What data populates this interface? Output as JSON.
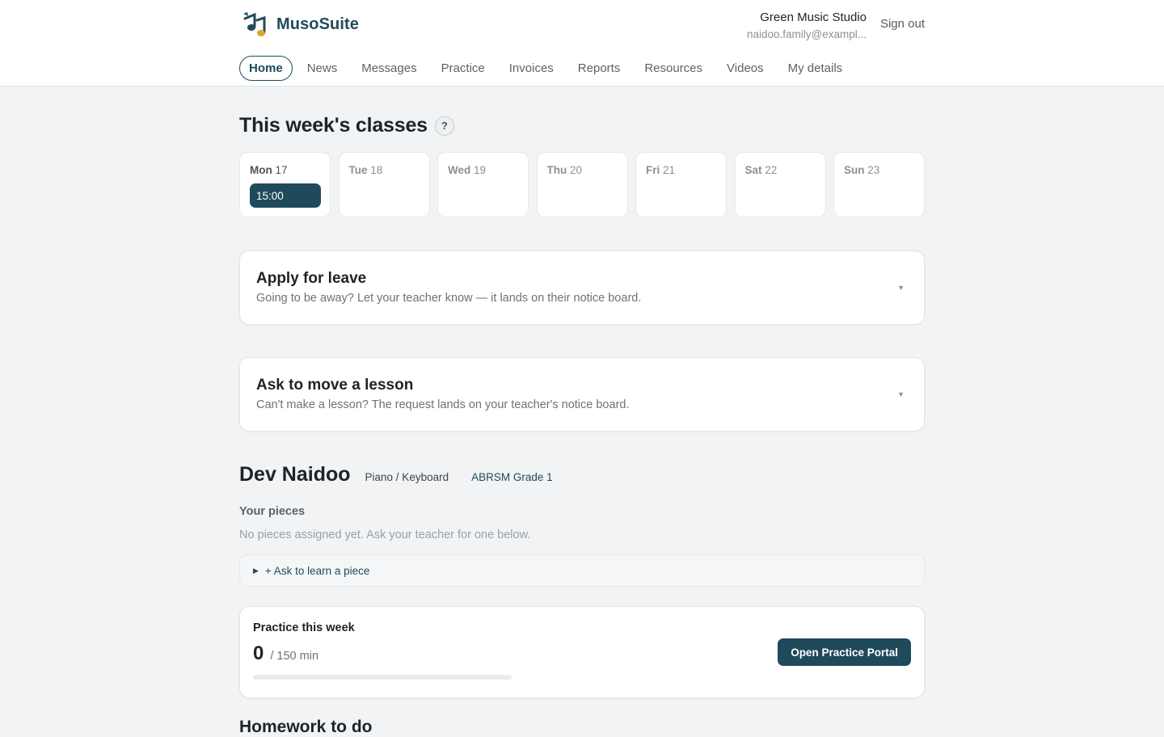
{
  "app": {
    "name": "MusoSuite",
    "logo_icon": "music-notes-icon"
  },
  "account": {
    "studio": "Green Music Studio",
    "email": "naidoo.family@exampl...",
    "sign_out": "Sign out"
  },
  "nav": {
    "items": [
      {
        "label": "Home",
        "active": true
      },
      {
        "label": "News"
      },
      {
        "label": "Messages"
      },
      {
        "label": "Practice"
      },
      {
        "label": "Invoices"
      },
      {
        "label": "Reports"
      },
      {
        "label": "Resources"
      },
      {
        "label": "Videos"
      },
      {
        "label": "My details"
      }
    ]
  },
  "week": {
    "title": "This week's classes",
    "help": "?",
    "days": [
      {
        "day": "Mon",
        "date": "17",
        "classes": [
          "15:00"
        ]
      },
      {
        "day": "Tue",
        "date": "18",
        "classes": []
      },
      {
        "day": "Wed",
        "date": "19",
        "classes": []
      },
      {
        "day": "Thu",
        "date": "20",
        "classes": []
      },
      {
        "day": "Fri",
        "date": "21",
        "classes": []
      },
      {
        "day": "Sat",
        "date": "22",
        "classes": []
      },
      {
        "day": "Sun",
        "date": "23",
        "classes": []
      }
    ]
  },
  "leave": {
    "title": "Apply for leave",
    "desc": "Going to be away? Let your teacher know — it lands on their notice board.",
    "caret": "▼"
  },
  "move": {
    "title": "Ask to move a lesson",
    "desc": "Can't make a lesson? The request lands on your teacher's notice board.",
    "caret": "▼"
  },
  "student": {
    "name": "Dev Naidoo",
    "instrument": "Piano / Keyboard",
    "grade": "ABRSM Grade 1",
    "pieces_label": "Your pieces",
    "pieces_empty": "No pieces assigned yet. Ask your teacher for one below.",
    "ask_piece": "+ Ask to learn a piece",
    "ask_piece_toggle": "▶"
  },
  "practice": {
    "title": "Practice this week",
    "minutes": "0",
    "target": "/ 150 min",
    "progress_fraction": 0,
    "button": "Open Practice Portal"
  },
  "homework": {
    "title": "Homework to do"
  },
  "colors": {
    "accent": "#1f4a5c",
    "background": "#f1f3f4"
  }
}
